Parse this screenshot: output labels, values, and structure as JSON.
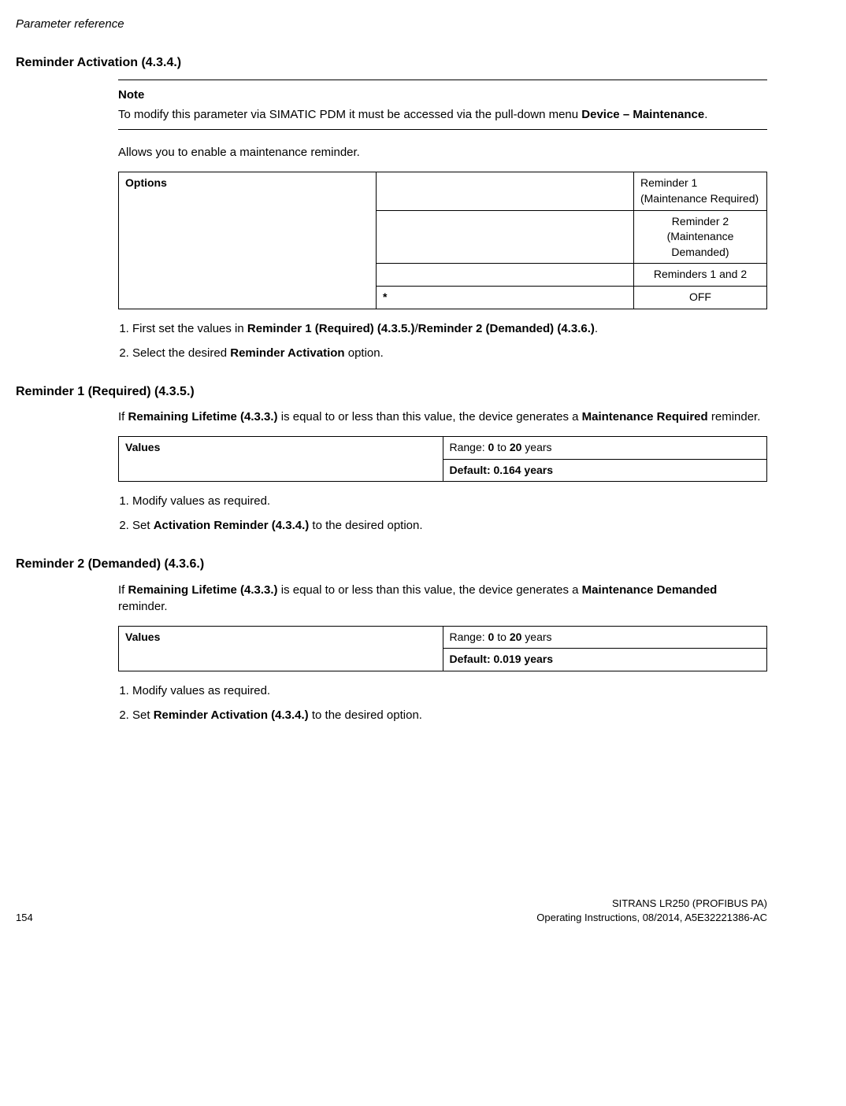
{
  "header": {
    "title": "Parameter reference"
  },
  "sections": {
    "s1": {
      "heading": "Reminder Activation (4.3.4.)",
      "note_title": "Note",
      "note_l1": "To modify this parameter via SIMATIC PDM it must be accessed via the pull-down menu ",
      "note_l2_bold": "Device – Maintenance",
      "note_l2_end": ".",
      "intro": "Allows you to enable a maintenance reminder.",
      "options_label": "Options",
      "opt1": "Reminder 1 (Maintenance Required)",
      "opt2": "Reminder 2 (Maintenance Demanded)",
      "opt3": "Reminders 1 and 2",
      "opt4_mark": "*",
      "opt4": "OFF",
      "step1_a": "First set the values in ",
      "step1_b": "Reminder 1 (Required) (4.3.5.)",
      "step1_c": "/",
      "step1_d": "Reminder 2 (Demanded) (4.3.6.)",
      "step1_e": ".",
      "step2_a": "Select the desired ",
      "step2_b": "Reminder Activation",
      "step2_c": " option."
    },
    "s2": {
      "heading": "Reminder 1 (Required) (4.3.5.)",
      "intro_a": "If ",
      "intro_b": "Remaining Lifetime (4.3.3.)",
      "intro_c": " is equal to or less than this value, the device generates a ",
      "intro_d": "Maintenance Required",
      "intro_e": " reminder.",
      "values_label": "Values",
      "range_a": "Range: ",
      "range_b": "0",
      "range_c": " to ",
      "range_d": "20",
      "range_e": " years",
      "default": "Default: 0.164 years",
      "step1": "Modify values as required.",
      "step2_a": "Set ",
      "step2_b": "Activation Reminder (4.3.4.)",
      "step2_c": " to the desired option."
    },
    "s3": {
      "heading": "Reminder 2 (Demanded) (4.3.6.)",
      "intro_a": "If ",
      "intro_b": "Remaining Lifetime (4.3.3.)",
      "intro_c": " is equal to or less than this value, the device generates a ",
      "intro_d": "Maintenance Demanded",
      "intro_e": " reminder.",
      "values_label": "Values",
      "range_a": "Range: ",
      "range_b": "0",
      "range_c": " to ",
      "range_d": "20",
      "range_e": " years",
      "default": "Default: 0.019 years",
      "step1": "Modify values as required.",
      "step2_a": "Set ",
      "step2_b": "Reminder Activation (4.3.4.)",
      "step2_c": " to the desired option."
    }
  },
  "footer": {
    "page": "154",
    "line1": "SITRANS LR250 (PROFIBUS PA)",
    "line2": "Operating Instructions, 08/2014, A5E32221386-AC"
  }
}
